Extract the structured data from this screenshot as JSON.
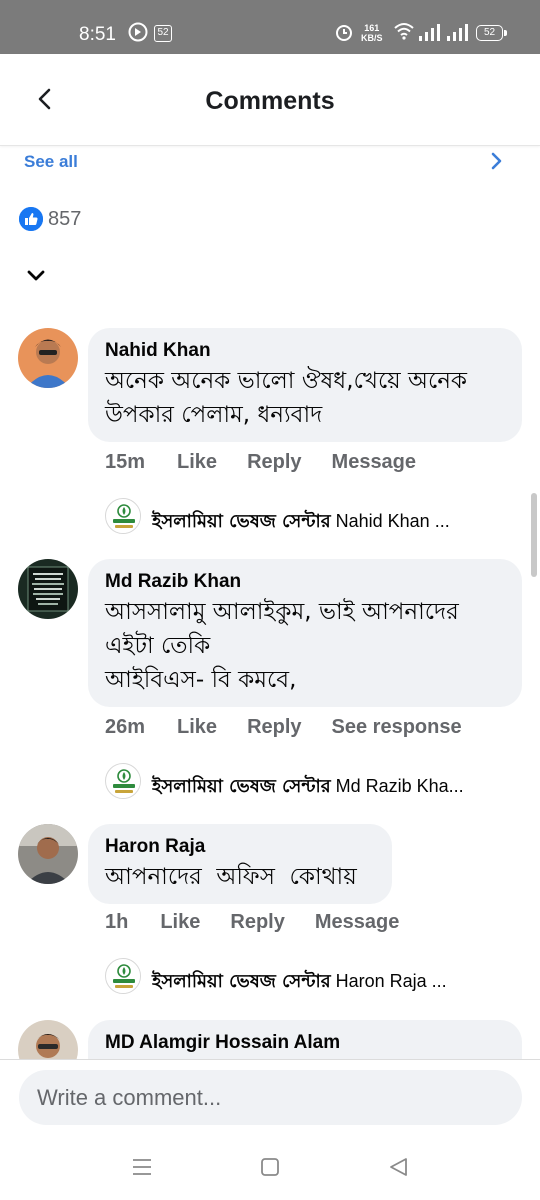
{
  "status_bar": {
    "time": "8:51",
    "notification_count": "52",
    "speed_value": "161",
    "speed_unit": "KB/S",
    "battery": "52"
  },
  "header": {
    "title": "Comments",
    "back_icon": "chevron-left-icon"
  },
  "see_all": {
    "label": "See all",
    "icon": "chevron-right-icon"
  },
  "reactions": {
    "icon": "thumbs-up-icon",
    "count": "857"
  },
  "sort_icon": "chevron-down-icon",
  "colors": {
    "accent_blue": "#1877f2",
    "link_blue": "#3b7dd8",
    "bubble_bg": "#f0f2f5",
    "meta_gray": "#65676b",
    "status_bar": "#7b7b7b"
  },
  "comments": [
    {
      "name": "Nahid Khan",
      "text_lines": [
        "অনেক অনেক ভালো ঔষধ,খেয়ে অনেক",
        "উপকার পেলাম, ধন্যবাদ"
      ],
      "time": "15m",
      "actions": [
        "Like",
        "Reply",
        "Message"
      ],
      "reply": {
        "page": "ইসলামিয়া ভেষজ সেন্টার",
        "preview": "Nahid Khan ..."
      }
    },
    {
      "name": "Md Razib Khan",
      "text_lines": [
        "আসসালামু আলাইকুম, ভাই আপনাদের",
        "এইটা তেকি",
        "আইবিএস- বি কমবে,"
      ],
      "time": "26m",
      "actions": [
        "Like",
        "Reply",
        "See response"
      ],
      "reply": {
        "page": "ইসলামিয়া ভেষজ সেন্টার",
        "preview": "Md Razib Kha..."
      }
    },
    {
      "name": "Haron Raja",
      "text_lines": [
        "আপনাদের  অফিস  কোথায়"
      ],
      "time": "1h",
      "actions": [
        "Like",
        "Reply",
        "Message"
      ],
      "reply": {
        "page": "ইসলামিয়া ভেষজ সেন্টার",
        "preview": "Haron Raja ..."
      }
    },
    {
      "name": "MD Alamgir Hossain Alam"
    }
  ],
  "composer": {
    "placeholder": "Write a comment..."
  }
}
